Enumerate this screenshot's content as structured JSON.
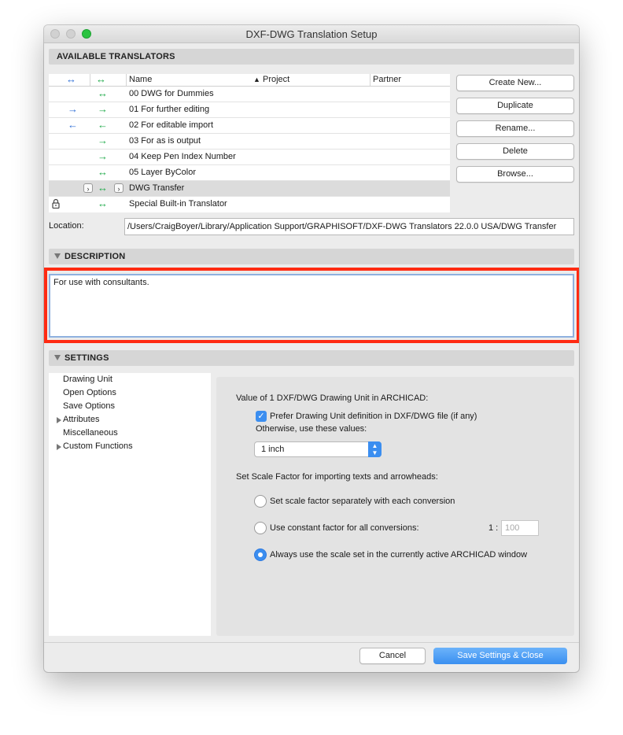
{
  "window": {
    "title": "DXF-DWG Translation Setup"
  },
  "sections": {
    "available_translators": "AVAILABLE TRANSLATORS",
    "description": "DESCRIPTION",
    "settings": "SETTINGS"
  },
  "table": {
    "headers": {
      "col1": "↔",
      "col2": "↔",
      "name": "Name",
      "project": "Project",
      "partner": "Partner"
    },
    "rows": [
      {
        "name": "00 DWG for Dummies",
        "col2": "↔"
      },
      {
        "name": "01 For further editing",
        "col1": "→",
        "col2": "→"
      },
      {
        "name": "02 For editable import",
        "col1": "←",
        "col2": "←"
      },
      {
        "name": "03 For as is output",
        "col2": "→"
      },
      {
        "name": "04 Keep Pen Index Number",
        "col2": "→"
      },
      {
        "name": "05 Layer ByColor",
        "col2": "↔"
      },
      {
        "name": "DWG Transfer",
        "col2": "↔",
        "expand_a": "›",
        "expand_b": "›"
      },
      {
        "name": "Special Built-in Translator",
        "col2": "↔"
      }
    ]
  },
  "buttons": {
    "create_new": "Create New...",
    "duplicate": "Duplicate",
    "rename": "Rename...",
    "delete": "Delete",
    "browse": "Browse...",
    "cancel": "Cancel",
    "save_close": "Save Settings & Close"
  },
  "location": {
    "label": "Location:",
    "value": "/Users/CraigBoyer/Library/Application Support/GRAPHISOFT/DXF-DWG Translators 22.0.0 USA/DWG Transfer"
  },
  "description": {
    "text": "For use with consultants."
  },
  "settings_tree": [
    {
      "label": "Drawing Unit"
    },
    {
      "label": "Open Options"
    },
    {
      "label": "Save Options"
    },
    {
      "label": "Attributes",
      "expandable": true
    },
    {
      "label": "Miscellaneous"
    },
    {
      "label": "Custom Functions",
      "expandable": true
    }
  ],
  "drawing_unit": {
    "heading": "Value of 1 DXF/DWG Drawing Unit in ARCHICAD:",
    "prefer_label": "Prefer Drawing Unit definition in DXF/DWG file (if any)",
    "prefer_checked": true,
    "otherwise": "Otherwise, use these values:",
    "unit_value": "1 inch",
    "scale_heading": "Set Scale Factor for importing texts and arrowheads:",
    "radio_separate": "Set scale factor separately with each conversion",
    "radio_constant": "Use constant factor for all conversions:",
    "ratio_prefix": "1 :",
    "ratio_placeholder": "100",
    "radio_active": "Always use the scale set in the currently active ARCHICAD window",
    "selected_option": "radio_active"
  },
  "colors": {
    "accent": "#3b8ef0",
    "highlight": "#ff2a12",
    "green_arrow": "#1faa4a",
    "blue_arrow": "#2f6fd6"
  }
}
